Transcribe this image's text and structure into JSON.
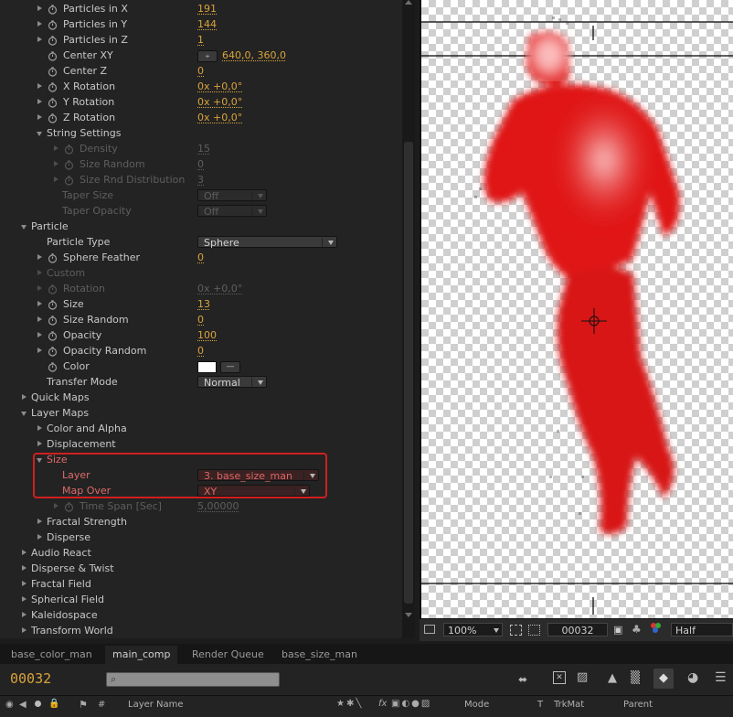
{
  "effects": {
    "rows": [
      {
        "label": "Particles in X",
        "value": "191",
        "indent": 2,
        "stopwatch": true,
        "twirl": "right",
        "type": "value"
      },
      {
        "label": "Particles in Y",
        "value": "144",
        "indent": 2,
        "stopwatch": true,
        "twirl": "right",
        "type": "value"
      },
      {
        "label": "Particles in Z",
        "value": "1",
        "indent": 2,
        "stopwatch": true,
        "twirl": "right",
        "type": "value"
      },
      {
        "label": "Center XY",
        "value": "640,0, 360,0",
        "indent": 2,
        "stopwatch": true,
        "twirl": "none",
        "type": "point"
      },
      {
        "label": "Center Z",
        "value": "0",
        "indent": 2,
        "stopwatch": true,
        "twirl": "none",
        "type": "value"
      },
      {
        "label": "X Rotation",
        "value": "0x +0,0°",
        "indent": 2,
        "stopwatch": true,
        "twirl": "right",
        "type": "value"
      },
      {
        "label": "Y Rotation",
        "value": "0x +0,0°",
        "indent": 2,
        "stopwatch": true,
        "twirl": "right",
        "type": "value"
      },
      {
        "label": "Z Rotation",
        "value": "0x +0,0°",
        "indent": 2,
        "stopwatch": true,
        "twirl": "right",
        "type": "value"
      },
      {
        "label": "String Settings",
        "indent": 2,
        "twirl": "down",
        "type": "group"
      },
      {
        "label": "Density",
        "value": "15",
        "indent": 3,
        "stopwatch": true,
        "twirl": "right",
        "type": "value",
        "dim": true
      },
      {
        "label": "Size Random",
        "value": "0",
        "indent": 3,
        "stopwatch": true,
        "twirl": "right",
        "type": "value",
        "dim": true
      },
      {
        "label": "Size Rnd Distribution",
        "value": "3",
        "indent": 3,
        "stopwatch": true,
        "twirl": "right",
        "type": "value",
        "dim": true
      },
      {
        "label": "Taper Size",
        "value": "Off",
        "indent": 3,
        "twirl": "none",
        "type": "dropdown",
        "dropdown_width": 76,
        "dim": true
      },
      {
        "label": "Taper Opacity",
        "value": "Off",
        "indent": 3,
        "twirl": "none",
        "type": "dropdown",
        "dropdown_width": 76,
        "dim": true
      },
      {
        "label": "Particle",
        "indent": 1,
        "twirl": "down",
        "type": "group"
      },
      {
        "label": "Particle Type",
        "value": "Sphere",
        "indent": 2,
        "twirl": "none",
        "type": "dropdown",
        "dropdown_width": 153
      },
      {
        "label": "Sphere Feather",
        "value": "0",
        "indent": 2,
        "stopwatch": true,
        "twirl": "right",
        "type": "value"
      },
      {
        "label": "Custom",
        "indent": 2,
        "twirl": "right",
        "type": "group",
        "dim": true
      },
      {
        "label": "Rotation",
        "value": "0x +0,0°",
        "indent": 2,
        "stopwatch": true,
        "twirl": "right",
        "type": "value",
        "dim": true
      },
      {
        "label": "Size",
        "value": "13",
        "indent": 2,
        "stopwatch": true,
        "twirl": "right",
        "type": "value"
      },
      {
        "label": "Size Random",
        "value": "0",
        "indent": 2,
        "stopwatch": true,
        "twirl": "right",
        "type": "value"
      },
      {
        "label": "Opacity",
        "value": "100",
        "indent": 2,
        "stopwatch": true,
        "twirl": "right",
        "type": "value"
      },
      {
        "label": "Opacity Random",
        "value": "0",
        "indent": 2,
        "stopwatch": true,
        "twirl": "right",
        "type": "value"
      },
      {
        "label": "Color",
        "indent": 2,
        "stopwatch": true,
        "twirl": "none",
        "type": "color"
      },
      {
        "label": "Transfer Mode",
        "value": "Normal",
        "indent": 2,
        "twirl": "none",
        "type": "dropdown",
        "dropdown_width": 76
      },
      {
        "label": "Quick Maps",
        "indent": 1,
        "twirl": "right",
        "type": "group"
      },
      {
        "label": "Layer Maps",
        "indent": 1,
        "twirl": "down",
        "type": "group"
      },
      {
        "label": "Color and Alpha",
        "indent": 2,
        "twirl": "right",
        "type": "group"
      },
      {
        "label": "Displacement",
        "indent": 2,
        "twirl": "right",
        "type": "group"
      },
      {
        "label": "Size",
        "indent": 2,
        "twirl": "down",
        "type": "group",
        "red": true
      },
      {
        "label": "Layer",
        "value": "3. base_size_man",
        "indent": 3,
        "twirl": "none",
        "type": "dropdown",
        "dropdown_width": 133,
        "red": true
      },
      {
        "label": "Map Over",
        "value": "XY",
        "indent": 3,
        "twirl": "none",
        "type": "dropdown",
        "dropdown_width": 123,
        "red": true
      },
      {
        "label": "Time Span [Sec]",
        "value": "5,00000",
        "indent": 3,
        "stopwatch": true,
        "twirl": "right",
        "type": "value",
        "dim": true
      },
      {
        "label": "Fractal Strength",
        "indent": 2,
        "twirl": "right",
        "type": "group"
      },
      {
        "label": "Disperse",
        "indent": 2,
        "twirl": "right",
        "type": "group"
      },
      {
        "label": "Audio React",
        "indent": 1,
        "twirl": "right",
        "type": "group"
      },
      {
        "label": "Disperse & Twist",
        "indent": 1,
        "twirl": "right",
        "type": "group"
      },
      {
        "label": "Fractal Field",
        "indent": 1,
        "twirl": "right",
        "type": "group"
      },
      {
        "label": "Spherical Field",
        "indent": 1,
        "twirl": "right",
        "type": "group"
      },
      {
        "label": "Kaleidospace",
        "indent": 1,
        "twirl": "right",
        "type": "group"
      },
      {
        "label": "Transform World",
        "indent": 1,
        "twirl": "right",
        "type": "group"
      }
    ]
  },
  "viewer": {
    "zoom": "100%",
    "timecode": "00032",
    "resolution": "Half"
  },
  "tabs": [
    {
      "label": "base_color_man",
      "active": false
    },
    {
      "label": "main_comp",
      "active": true
    },
    {
      "label": "Render Queue",
      "active": false
    },
    {
      "label": "base_size_man",
      "active": false
    }
  ],
  "timeline": {
    "current_time": "00032",
    "search_placeholder": "",
    "headers": {
      "layer_name": "Layer Name",
      "mode": "Mode",
      "t": "T",
      "trkmat": "TrkMat",
      "parent": "Parent",
      "hash": "#"
    }
  },
  "colors": {
    "accent": "#d9a33c",
    "highlight": "#d01f1f",
    "particle": "#e01818"
  }
}
